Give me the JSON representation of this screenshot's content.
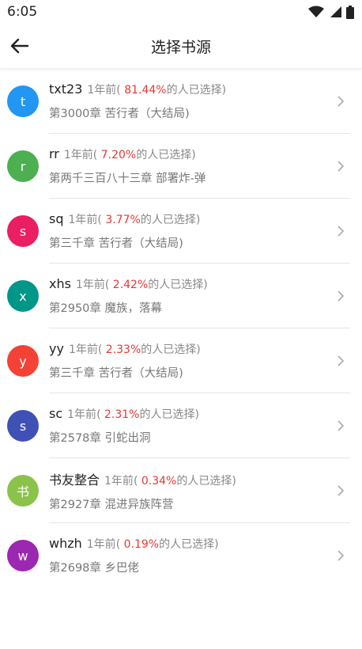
{
  "status": {
    "time": "6:05"
  },
  "header": {
    "title": "选择书源",
    "back_icon": "arrow-left-icon"
  },
  "sources": [
    {
      "initial": "t",
      "name": "txt23",
      "time": "1年前",
      "percent": "81.44%",
      "suffix": "的人已选择)",
      "chapter": "第3000章 苦行者（大结局)",
      "color": "#2196F3"
    },
    {
      "initial": "r",
      "name": "rr",
      "time": "1年前",
      "percent": "7.20%",
      "suffix": "的人已选择)",
      "chapter": "第两千三百八十三章 部署炸-弹",
      "color": "#4CAF50"
    },
    {
      "initial": "s",
      "name": "sq",
      "time": "1年前",
      "percent": "3.77%",
      "suffix": "的人已选择)",
      "chapter": "第三千章 苦行者（大结局)",
      "color": "#E91E63"
    },
    {
      "initial": "x",
      "name": "xhs",
      "time": "1年前",
      "percent": "2.42%",
      "suffix": "的人已选择)",
      "chapter": "第2950章 魔族，落幕",
      "color": "#009688"
    },
    {
      "initial": "y",
      "name": "yy",
      "time": "1年前",
      "percent": "2.33%",
      "suffix": "的人已选择)",
      "chapter": "第三千章 苦行者（大结局)",
      "color": "#F44336"
    },
    {
      "initial": "s",
      "name": "sc",
      "time": "1年前",
      "percent": "2.31%",
      "suffix": "的人已选择)",
      "chapter": "第2578章 引蛇出洞",
      "color": "#3F51B5"
    },
    {
      "initial": "书",
      "name": "书友整合",
      "time": "1年前",
      "percent": "0.34%",
      "suffix": "的人已选择)",
      "chapter": "第2927章 混进异族阵营",
      "color": "#8BC34A"
    },
    {
      "initial": "w",
      "name": "whzh",
      "time": "1年前",
      "percent": "0.19%",
      "suffix": "的人已选择)",
      "chapter": "第2698章 乡巴佬",
      "color": "#9C27B0"
    }
  ]
}
